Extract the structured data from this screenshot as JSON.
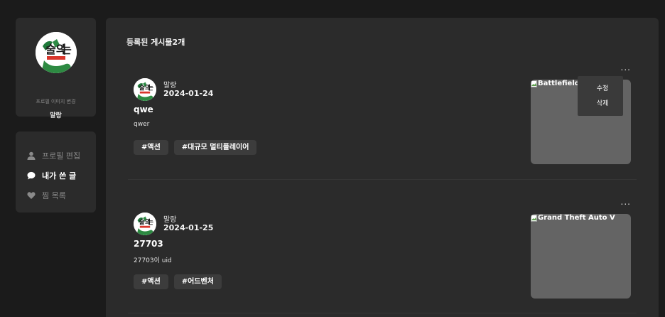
{
  "profile": {
    "change_image_label": "프로필 이미지 변경",
    "nickname": "말랑"
  },
  "menu": {
    "items": [
      {
        "label": "프로필 편집",
        "icon": "user-icon",
        "active": false
      },
      {
        "label": "내가 쓴 글",
        "icon": "chat-bubble-icon",
        "active": true
      },
      {
        "label": "찜 목록",
        "icon": "heart-icon",
        "active": false
      }
    ]
  },
  "main": {
    "post_count_label": "등록된 게시물2개",
    "posts": [
      {
        "author": "말랑",
        "date": "2024-01-24",
        "title": "qwe",
        "body": "qwer",
        "tags": [
          "#액션",
          "#대규모 멀티플레이어"
        ],
        "image_alt": "Battlefield™ 2042",
        "more_label": "..."
      },
      {
        "author": "말랑",
        "date": "2024-01-25",
        "title": "27703",
        "body": "27703이 uid",
        "tags": [
          "#액션",
          "#어드벤처"
        ],
        "image_alt": "Grand Theft Auto V",
        "more_label": "..."
      }
    ],
    "dropdown": {
      "edit_label": "수정",
      "delete_label": "삭제"
    }
  },
  "colors": {
    "page_bg": "#1b1b1b",
    "card_bg": "#2b2b2b",
    "tag_bg": "#3c3c3c",
    "thumb_bg": "#646464",
    "muted_text": "#8a8a8a"
  }
}
